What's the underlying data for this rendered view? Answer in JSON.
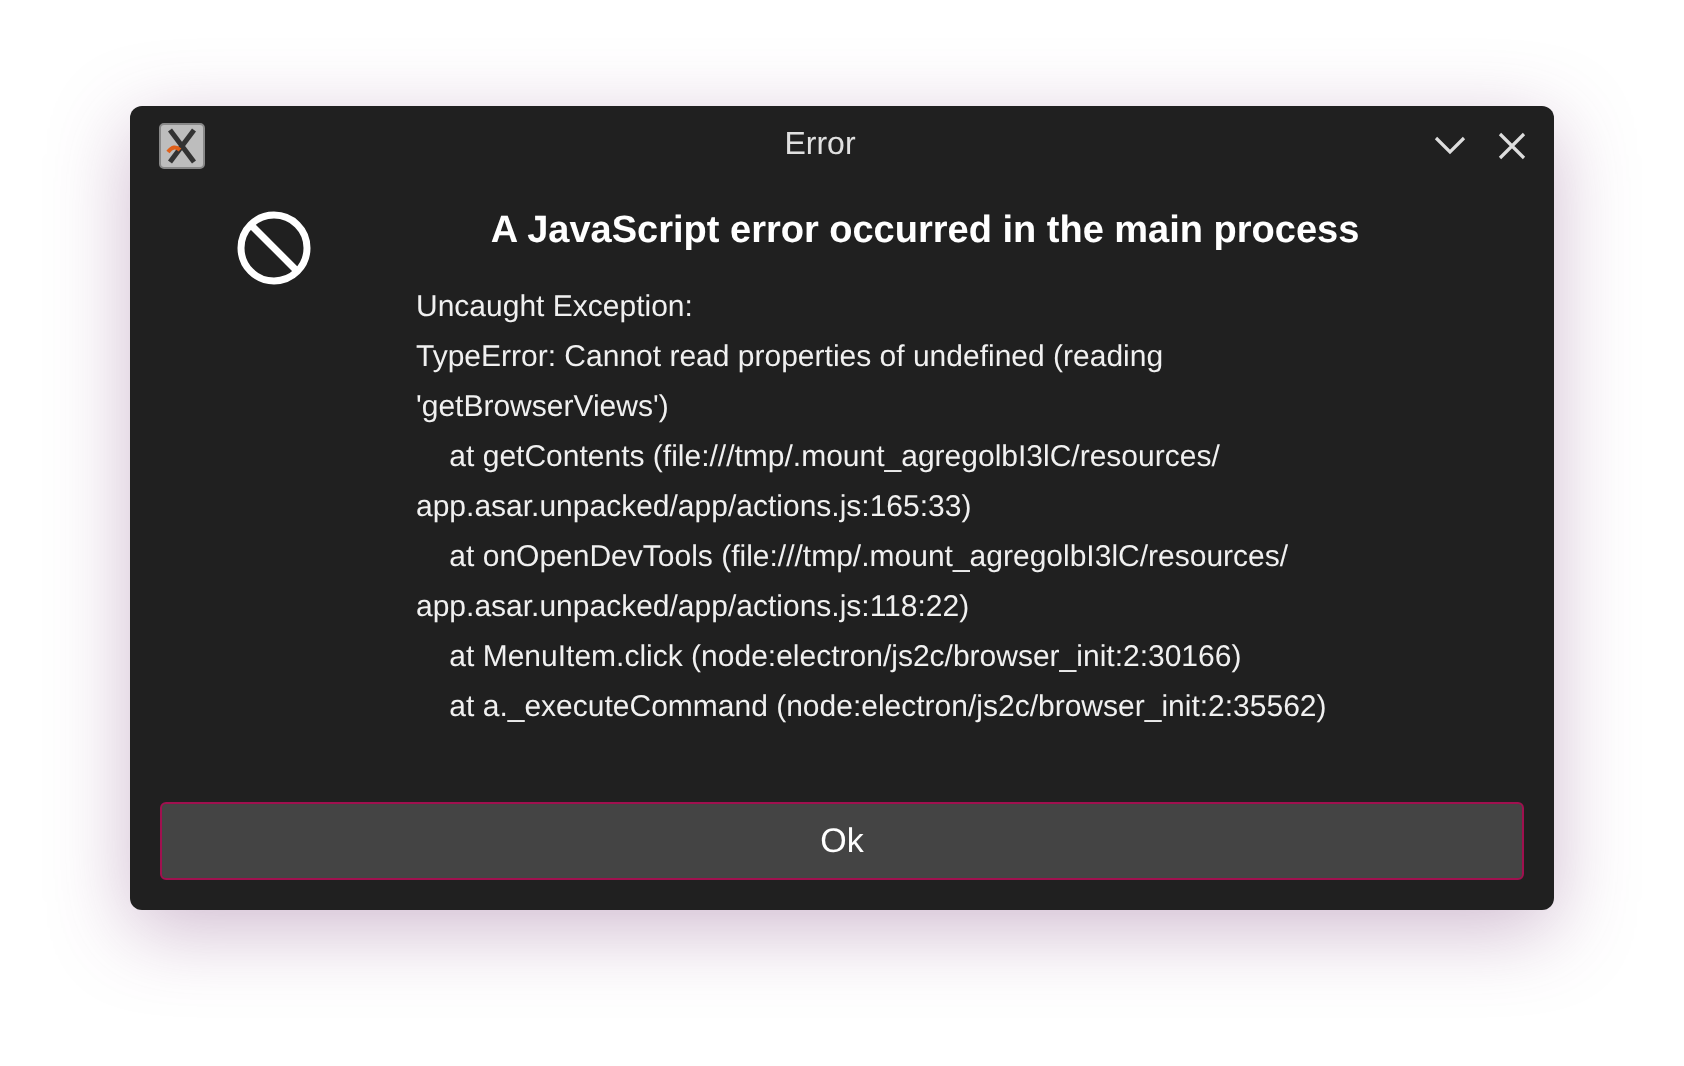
{
  "window": {
    "title": "Error"
  },
  "dialog": {
    "heading": "A JavaScript error occurred in the main process",
    "message_lines": [
      "Uncaught Exception:",
      "TypeError: Cannot read properties of undefined (reading",
      "'getBrowserViews')",
      "    at getContents (file:///tmp/.mount_agregolbI3lC/resources/",
      "app.asar.unpacked/app/actions.js:165:33)",
      "    at onOpenDevTools (file:///tmp/.mount_agregolbI3lC/resources/",
      "app.asar.unpacked/app/actions.js:118:22)",
      "    at MenuItem.click (node:electron/js2c/browser_init:2:30166)",
      "    at a._executeCommand (node:electron/js2c/browser_init:2:35562)"
    ]
  },
  "buttons": [
    {
      "label": "Ok",
      "focused": true
    }
  ]
}
